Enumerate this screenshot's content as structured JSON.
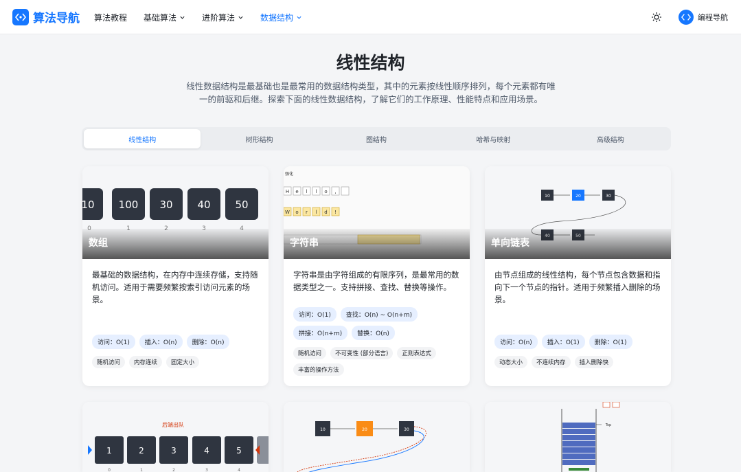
{
  "header": {
    "logo": "算法导航",
    "nav": [
      {
        "label": "算法教程",
        "dropdown": false,
        "active": false
      },
      {
        "label": "基础算法",
        "dropdown": true,
        "active": false
      },
      {
        "label": "进阶算法",
        "dropdown": true,
        "active": false
      },
      {
        "label": "数据结构",
        "dropdown": true,
        "active": true
      }
    ],
    "theme_icon": "sun-icon",
    "user_name": "编程导航"
  },
  "page": {
    "title": "线性结构",
    "description": "线性数据结构是最基础也是最常用的数据结构类型，其中的元素按线性顺序排列，每个元素都有唯一的前驱和后继。探索下面的线性数据结构，了解它们的工作原理、性能特点和应用场景。"
  },
  "tabs": [
    {
      "label": "线性结构",
      "active": true
    },
    {
      "label": "树形结构",
      "active": false
    },
    {
      "label": "图结构",
      "active": false
    },
    {
      "label": "哈希与映射",
      "active": false
    },
    {
      "label": "高级结构",
      "active": false
    }
  ],
  "cards": [
    {
      "title": "数组",
      "description": "最基础的数据结构，在内存中连续存储，支持随机访问。适用于需要频繁按索引访问元素的场景。",
      "badges": [
        "访问：O(1)",
        "插入：O(n)",
        "删除：O(n)"
      ],
      "tags": [
        "随机访问",
        "内存连续",
        "固定大小"
      ],
      "preview": {
        "values": [
          "10",
          "100",
          "30",
          "40",
          "50"
        ],
        "indices": [
          "0",
          "1",
          "2",
          "3",
          "4"
        ]
      }
    },
    {
      "title": "字符串",
      "description": "字符串是由字符组成的有限序列，是最常用的数据类型之一。支持拼接、查找、替换等操作。",
      "badges": [
        "访问：O(1)",
        "查找：O(n) ~ O(n+m)",
        "拼接：O(n+m)",
        "替换：O(n)"
      ],
      "tags": [
        "随机访问",
        "不可变性 (部分语言)",
        "正则表达式",
        "丰富的操作方法"
      ],
      "preview": {
        "label": "强化",
        "row1": [
          "H",
          "e",
          "l",
          "l",
          "o",
          ","
        ],
        "row2": [
          "W",
          "o",
          "r",
          "l",
          "d",
          "!"
        ]
      }
    },
    {
      "title": "单向链表",
      "description": "由节点组成的线性结构，每个节点包含数据和指向下一个节点的指针。适用于频繁插入删除的场景。",
      "badges": [
        "访问：O(n)",
        "插入：O(1)",
        "删除：O(1)"
      ],
      "tags": [
        "动态大小",
        "不连续内存",
        "插入删除快"
      ],
      "preview": {
        "nodes": [
          "10",
          "20",
          "30",
          "40",
          "50"
        ]
      }
    },
    {
      "preview": {
        "label": "后端出队",
        "values": [
          "1",
          "2",
          "3",
          "4",
          "5"
        ],
        "indices": [
          "0",
          "1",
          "2",
          "3",
          "4"
        ]
      }
    },
    {
      "preview": {
        "nodes": [
          "10",
          "20",
          "30"
        ]
      }
    },
    {
      "preview": {
        "top_label": "Top"
      }
    }
  ]
}
